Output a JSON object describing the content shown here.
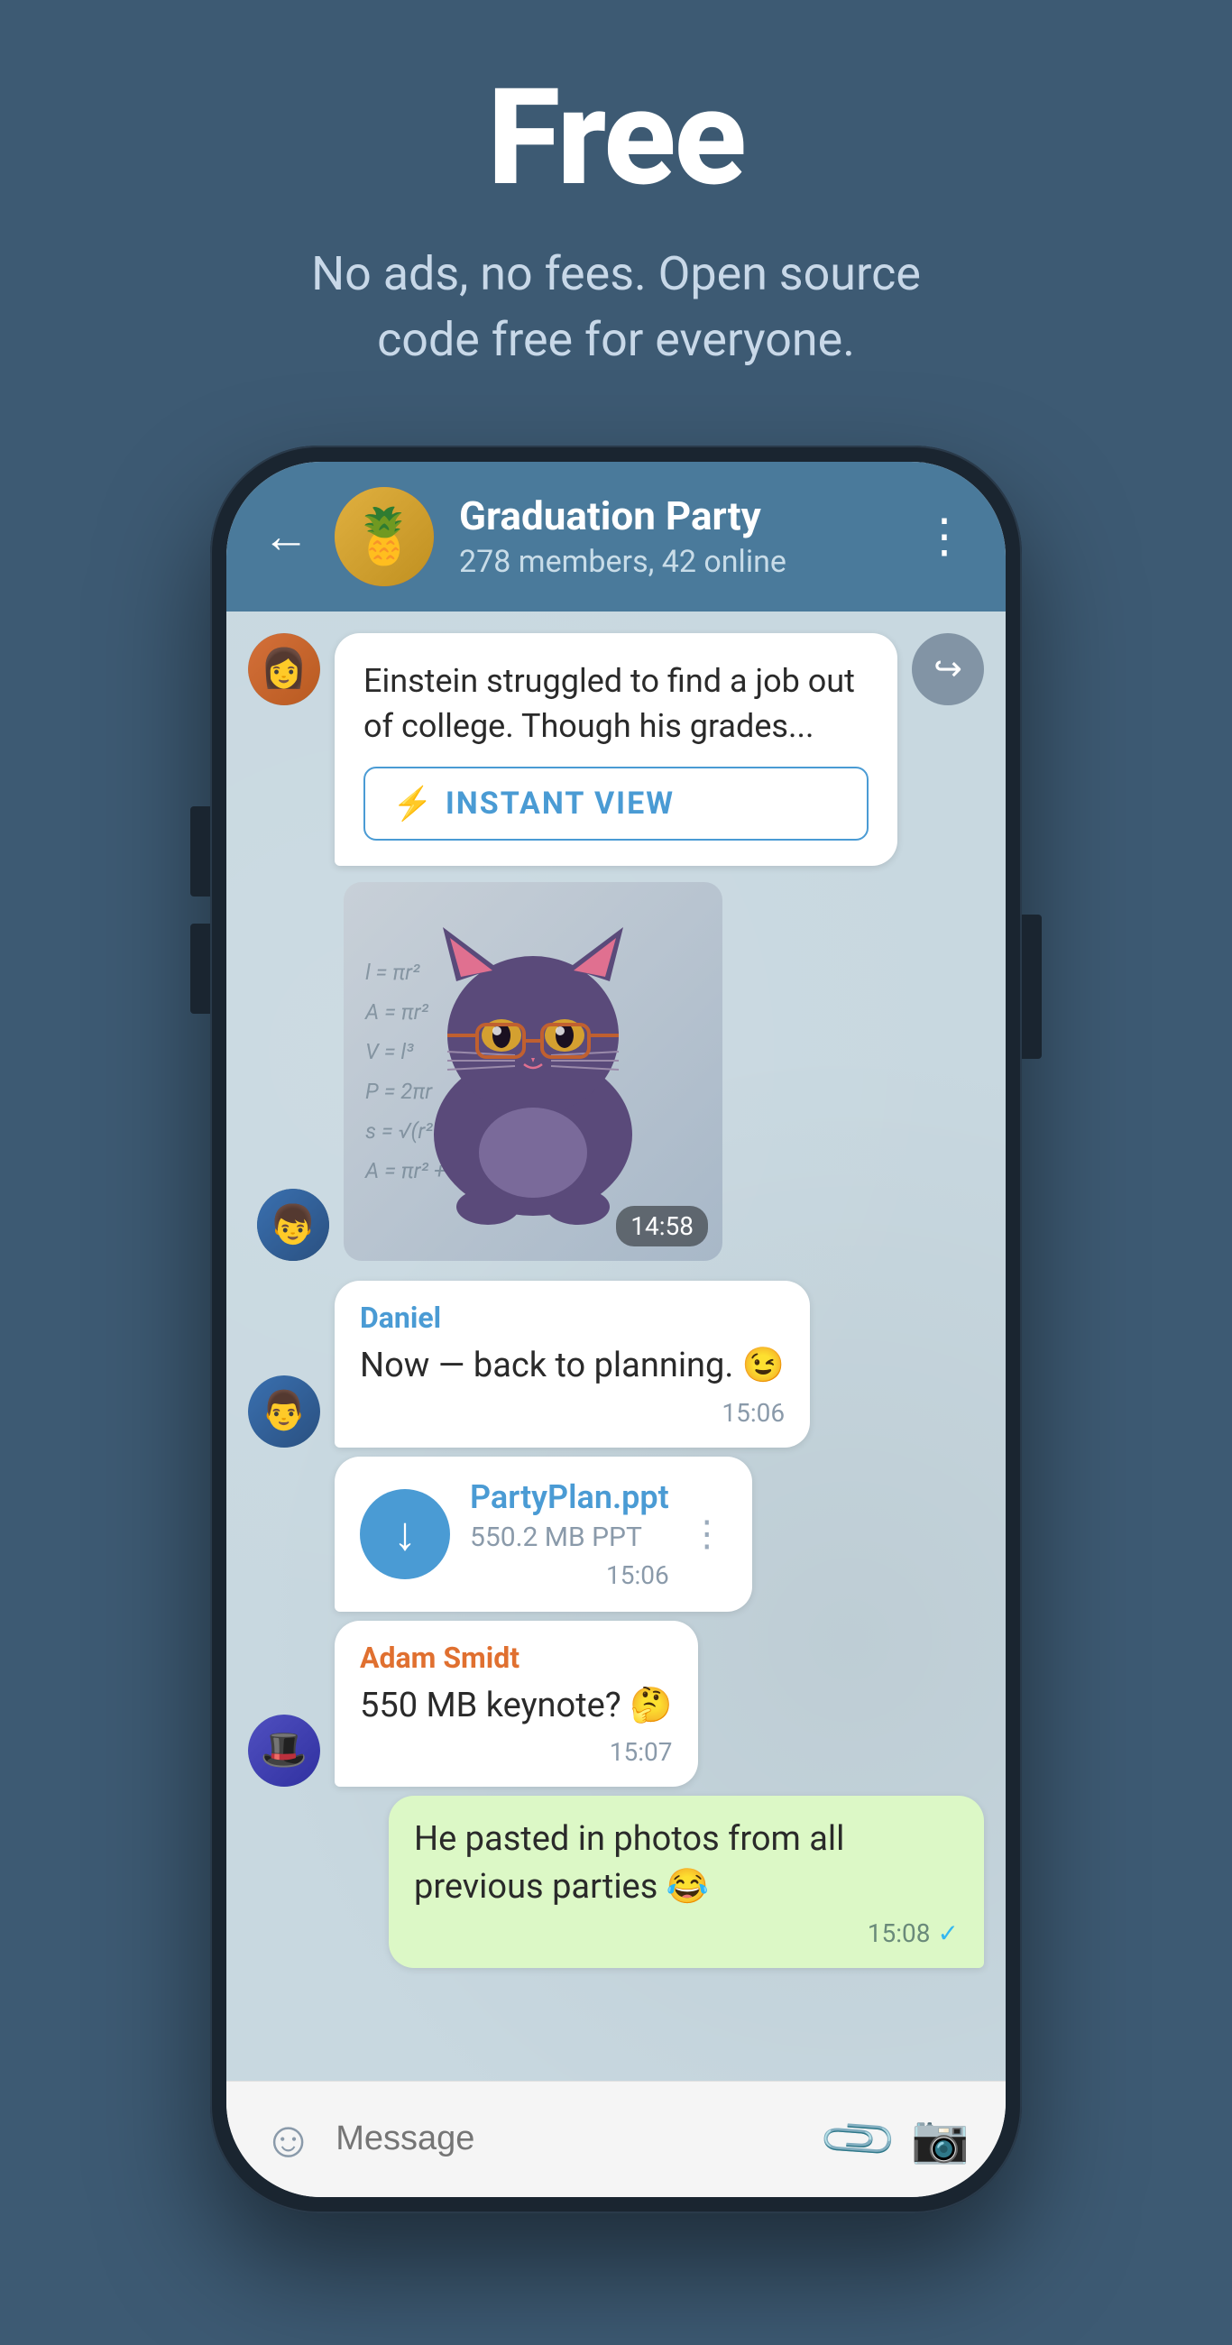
{
  "hero": {
    "title": "Free",
    "subtitle": "No ads, no fees. Open source code free for everyone."
  },
  "chat": {
    "group_name": "Graduation Party",
    "group_members": "278 members, 42 online",
    "back_label": "←",
    "more_label": "⋮",
    "instant_view_text": "Einstein struggled to find a job out of college. Though his grades...",
    "instant_view_btn": "INSTANT VIEW",
    "sticker_time": "14:58",
    "messages": [
      {
        "sender": "Daniel",
        "text": "Now — back to planning. 😉",
        "time": "15:06",
        "type": "text-left"
      },
      {
        "sender": "",
        "filename": "PartyPlan.ppt",
        "filesize": "550.2 MB PPT",
        "time": "15:06",
        "type": "file"
      },
      {
        "sender": "Adam Smidt",
        "text": "550 MB keynote? 🤔",
        "time": "15:07",
        "type": "text-left-orange"
      },
      {
        "sender": "",
        "text": "He pasted in photos from all previous parties 😂",
        "time": "15:08",
        "type": "text-right"
      }
    ],
    "input_placeholder": "Message"
  }
}
